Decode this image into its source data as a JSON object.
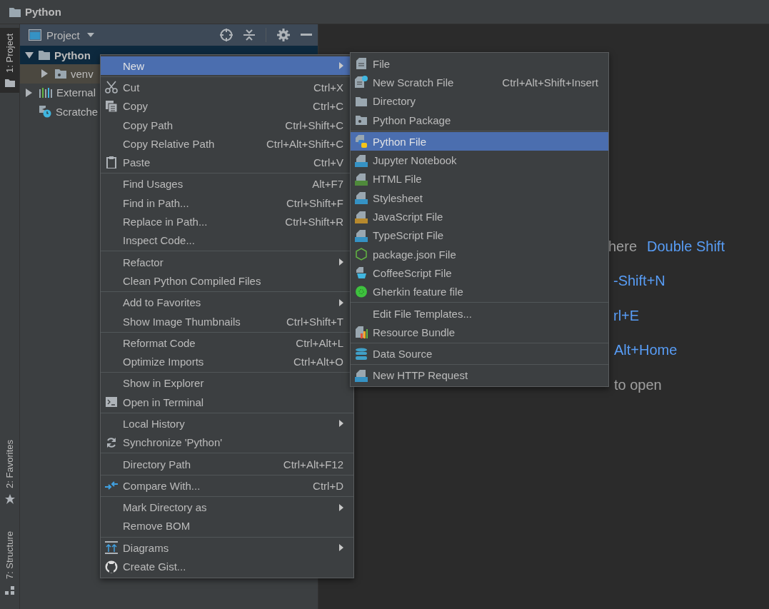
{
  "title_bar": {
    "title": "Python"
  },
  "side_tabs": {
    "top": [
      {
        "label": "1: Project",
        "selected": true
      }
    ],
    "bottom": [
      {
        "label": "2: Favorites",
        "selected": false
      },
      {
        "label": "7: Structure",
        "selected": false
      }
    ]
  },
  "project_panel": {
    "view": "Project",
    "tree": [
      {
        "label": "Python",
        "kind": "project",
        "expanded": true,
        "selected": true,
        "children": [
          {
            "label": "venv",
            "kind": "folder",
            "expanded": false,
            "selected": false,
            "excluded": true
          }
        ]
      },
      {
        "label": "External",
        "kind": "libraries",
        "expanded": false,
        "selected": false,
        "excluded": false
      },
      {
        "label": "Scratche",
        "kind": "scratches",
        "selected": false,
        "excluded": false
      }
    ]
  },
  "welcome": {
    "lines": [
      [
        {
          "text": "here",
          "kind": "text"
        },
        {
          "text": "Double Shift",
          "kind": "shortcut"
        }
      ],
      [
        {
          "text": "-Shift+N",
          "kind": "shortcut"
        }
      ],
      [
        {
          "text": "rl+E",
          "kind": "shortcut"
        }
      ],
      [
        {
          "text": "Alt+Home",
          "kind": "shortcut"
        }
      ],
      [
        {
          "text": "to open",
          "kind": "text"
        }
      ]
    ]
  },
  "context_menu": {
    "groups": [
      [
        {
          "label": "New",
          "submenu": true,
          "selected": true
        }
      ],
      [
        {
          "label": "Cut",
          "shortcut": "Ctrl+X",
          "submenu": false,
          "selected": false
        },
        {
          "label": "Copy",
          "shortcut": "Ctrl+C",
          "submenu": false,
          "selected": false
        },
        {
          "label": "Copy Path",
          "shortcut": "Ctrl+Shift+C",
          "submenu": false,
          "selected": false
        },
        {
          "label": "Copy Relative Path",
          "shortcut": "Ctrl+Alt+Shift+C",
          "submenu": false,
          "selected": false
        },
        {
          "label": "Paste",
          "shortcut": "Ctrl+V",
          "submenu": false,
          "selected": false
        }
      ],
      [
        {
          "label": "Find Usages",
          "shortcut": "Alt+F7",
          "submenu": false,
          "selected": false
        },
        {
          "label": "Find in Path...",
          "shortcut": "Ctrl+Shift+F",
          "submenu": false,
          "selected": false
        },
        {
          "label": "Replace in Path...",
          "shortcut": "Ctrl+Shift+R",
          "submenu": false,
          "selected": false
        },
        {
          "label": "Inspect Code...",
          "submenu": false,
          "selected": false
        }
      ],
      [
        {
          "label": "Refactor",
          "submenu": true,
          "selected": false
        },
        {
          "label": "Clean Python Compiled Files",
          "submenu": false,
          "selected": false
        }
      ],
      [
        {
          "label": "Add to Favorites",
          "submenu": true,
          "selected": false
        },
        {
          "label": "Show Image Thumbnails",
          "shortcut": "Ctrl+Shift+T",
          "submenu": false,
          "selected": false
        }
      ],
      [
        {
          "label": "Reformat Code",
          "shortcut": "Ctrl+Alt+L",
          "submenu": false,
          "selected": false
        },
        {
          "label": "Optimize Imports",
          "shortcut": "Ctrl+Alt+O",
          "submenu": false,
          "selected": false
        }
      ],
      [
        {
          "label": "Show in Explorer",
          "submenu": false,
          "selected": false
        },
        {
          "label": "Open in Terminal",
          "submenu": false,
          "selected": false
        }
      ],
      [
        {
          "label": "Local History",
          "submenu": true,
          "selected": false
        },
        {
          "label": "Synchronize 'Python'",
          "submenu": false,
          "selected": false
        }
      ],
      [
        {
          "label": "Directory Path",
          "shortcut": "Ctrl+Alt+F12",
          "submenu": false,
          "selected": false
        }
      ],
      [
        {
          "label": "Compare With...",
          "shortcut": "Ctrl+D",
          "submenu": false,
          "selected": false
        }
      ],
      [
        {
          "label": "Mark Directory as",
          "submenu": true,
          "selected": false
        },
        {
          "label": "Remove BOM",
          "submenu": false,
          "selected": false
        }
      ],
      [
        {
          "label": "Diagrams",
          "submenu": true,
          "selected": false
        },
        {
          "label": "Create Gist...",
          "submenu": false,
          "selected": false
        }
      ]
    ]
  },
  "new_submenu": {
    "groups": [
      [
        {
          "label": "File",
          "submenu": false,
          "selected": false
        },
        {
          "label": "New Scratch File",
          "shortcut": "Ctrl+Alt+Shift+Insert",
          "submenu": false,
          "selected": false
        },
        {
          "label": "Directory",
          "submenu": false,
          "selected": false
        },
        {
          "label": "Python Package",
          "submenu": false,
          "selected": false
        }
      ],
      [
        {
          "label": "Python File",
          "submenu": false,
          "selected": true
        },
        {
          "label": "Jupyter Notebook",
          "submenu": false,
          "selected": false
        },
        {
          "label": "HTML File",
          "submenu": false,
          "selected": false
        },
        {
          "label": "Stylesheet",
          "submenu": false,
          "selected": false
        },
        {
          "label": "JavaScript File",
          "submenu": false,
          "selected": false
        },
        {
          "label": "TypeScript File",
          "submenu": false,
          "selected": false
        },
        {
          "label": "package.json File",
          "submenu": false,
          "selected": false
        },
        {
          "label": "CoffeeScript File",
          "submenu": false,
          "selected": false
        },
        {
          "label": "Gherkin feature file",
          "submenu": false,
          "selected": false
        }
      ],
      [
        {
          "label": "Edit File Templates...",
          "submenu": false,
          "selected": false
        },
        {
          "label": "Resource Bundle",
          "submenu": false,
          "selected": false
        }
      ],
      [
        {
          "label": "Data Source",
          "submenu": false,
          "selected": false
        }
      ],
      [
        {
          "label": "New HTTP Request",
          "submenu": false,
          "selected": false
        }
      ]
    ]
  }
}
